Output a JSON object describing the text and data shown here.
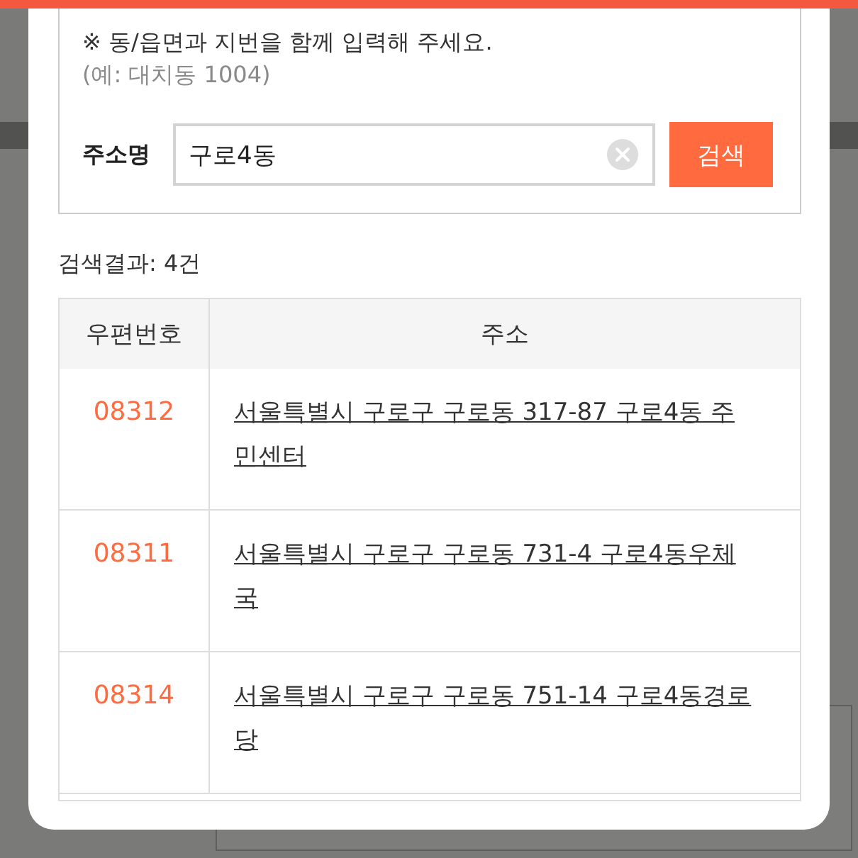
{
  "notice": {
    "text": "※ 동/읍면과 지번을 함께 입력해 주세요.",
    "example": "(예: 대치동 1004)"
  },
  "search": {
    "label": "주소명",
    "value": "구로4동",
    "button": "검색"
  },
  "result_count": "검색결과: 4건",
  "table": {
    "columns": [
      "우편번호",
      "주소"
    ],
    "rows": [
      {
        "postcode": "08312",
        "address": "서울특별시 구로구 구로동 317-87 구로4동 주민센터"
      },
      {
        "postcode": "08311",
        "address": "서울특별시 구로구 구로동 731-4 구로4동우체국"
      },
      {
        "postcode": "08314",
        "address": "서울특별시 구로구 구로동 751-14 구로4동경로당"
      }
    ]
  }
}
